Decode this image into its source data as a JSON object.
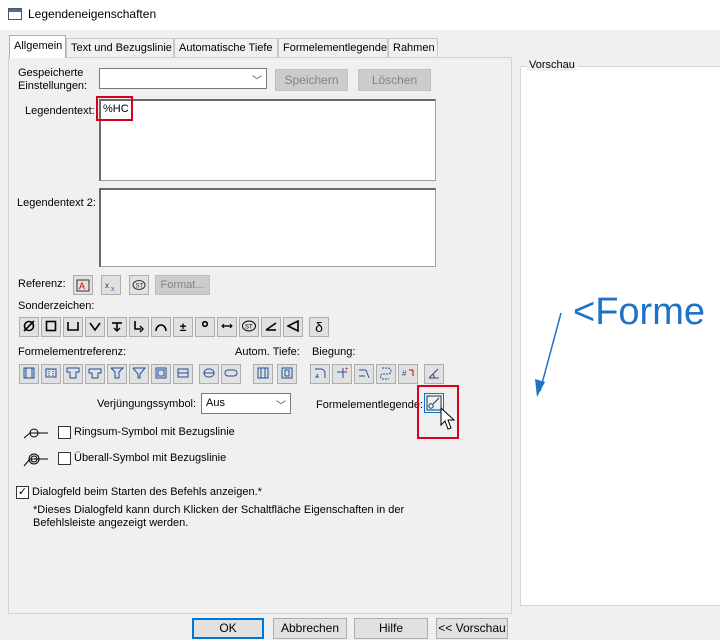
{
  "window": {
    "title": "Legendeneigenschaften"
  },
  "tabs": [
    {
      "label": "Allgemein",
      "active": true
    },
    {
      "label": "Text und Bezugslinie"
    },
    {
      "label": "Automatische Tiefe"
    },
    {
      "label": "Formelementlegende"
    },
    {
      "label": "Rahmen"
    }
  ],
  "saved_settings": {
    "label_line1": "Gespeicherte",
    "label_line2": "Einstellungen:",
    "value": "",
    "save_label": "Speichern",
    "delete_label": "Löschen"
  },
  "legend_text": {
    "label": "Legendentext:",
    "value": "%HC"
  },
  "legend_text2": {
    "label": "Legendentext 2:",
    "value": ""
  },
  "reference": {
    "label": "Referenz:",
    "format_label": "Format..."
  },
  "special_chars": {
    "label": "Sonderzeichen:",
    "pm": "±",
    "delta": "δ"
  },
  "feature_ref": {
    "label": "Formelementreferenz:",
    "auto_depth_label": "Autom. Tiefe:",
    "bend_label": "Biegung:"
  },
  "taper": {
    "label": "Verjüngungssymbol:",
    "value": "Aus"
  },
  "feature_legend": {
    "label": "Formelementlegende:"
  },
  "all_around": {
    "label": "Ringsum-Symbol mit Bezugslinie",
    "checked": false
  },
  "all_over": {
    "label": "Überall-Symbol mit Bezugslinie",
    "checked": false
  },
  "show_dialog": {
    "label": "Dialogfeld beim Starten des Befehls anzeigen.*",
    "checked": true,
    "note_line1": "*Dieses Dialogfeld kann durch Klicken der Schaltfläche Eigenschaften in der",
    "note_line2": "Befehlsleiste angezeigt werden."
  },
  "preview": {
    "label": "Vorschau",
    "text": "<Forme"
  },
  "buttons": {
    "ok": "OK",
    "cancel": "Abbrechen",
    "help": "Hilfe",
    "preview": "<< Vorschau"
  },
  "colors": {
    "accent": "#0078d7",
    "highlight": "#d9001b",
    "preview_text": "#1e73c8"
  }
}
